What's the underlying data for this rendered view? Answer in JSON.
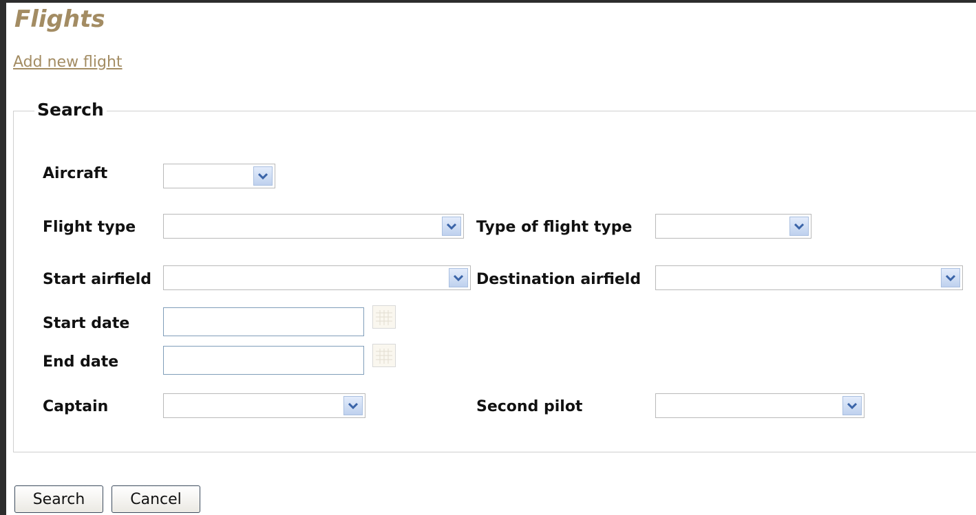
{
  "page_title": "Flights",
  "add_link": "Add new flight",
  "search_legend": "Search",
  "labels": {
    "aircraft": "Aircraft",
    "flight_type": "Flight type",
    "type_of_flight_type": "Type of flight type",
    "start_airfield": "Start airfield",
    "destination_airfield": "Destination airfield",
    "start_date": "Start date",
    "end_date": "End date",
    "captain": "Captain",
    "second_pilot": "Second pilot"
  },
  "fields": {
    "aircraft": "",
    "flight_type": "",
    "type_of_flight_type": "",
    "start_airfield": "",
    "destination_airfield": "",
    "start_date": "",
    "end_date": "",
    "captain": "",
    "second_pilot": ""
  },
  "buttons": {
    "search": "Search",
    "cancel": "Cancel"
  },
  "icons": {
    "dropdown": "chevron-down-icon",
    "calendar": "calendar-icon"
  },
  "colors": {
    "title": "#a38c63",
    "link": "#a38c63",
    "dropdown_arrow": "#3a64a8"
  }
}
